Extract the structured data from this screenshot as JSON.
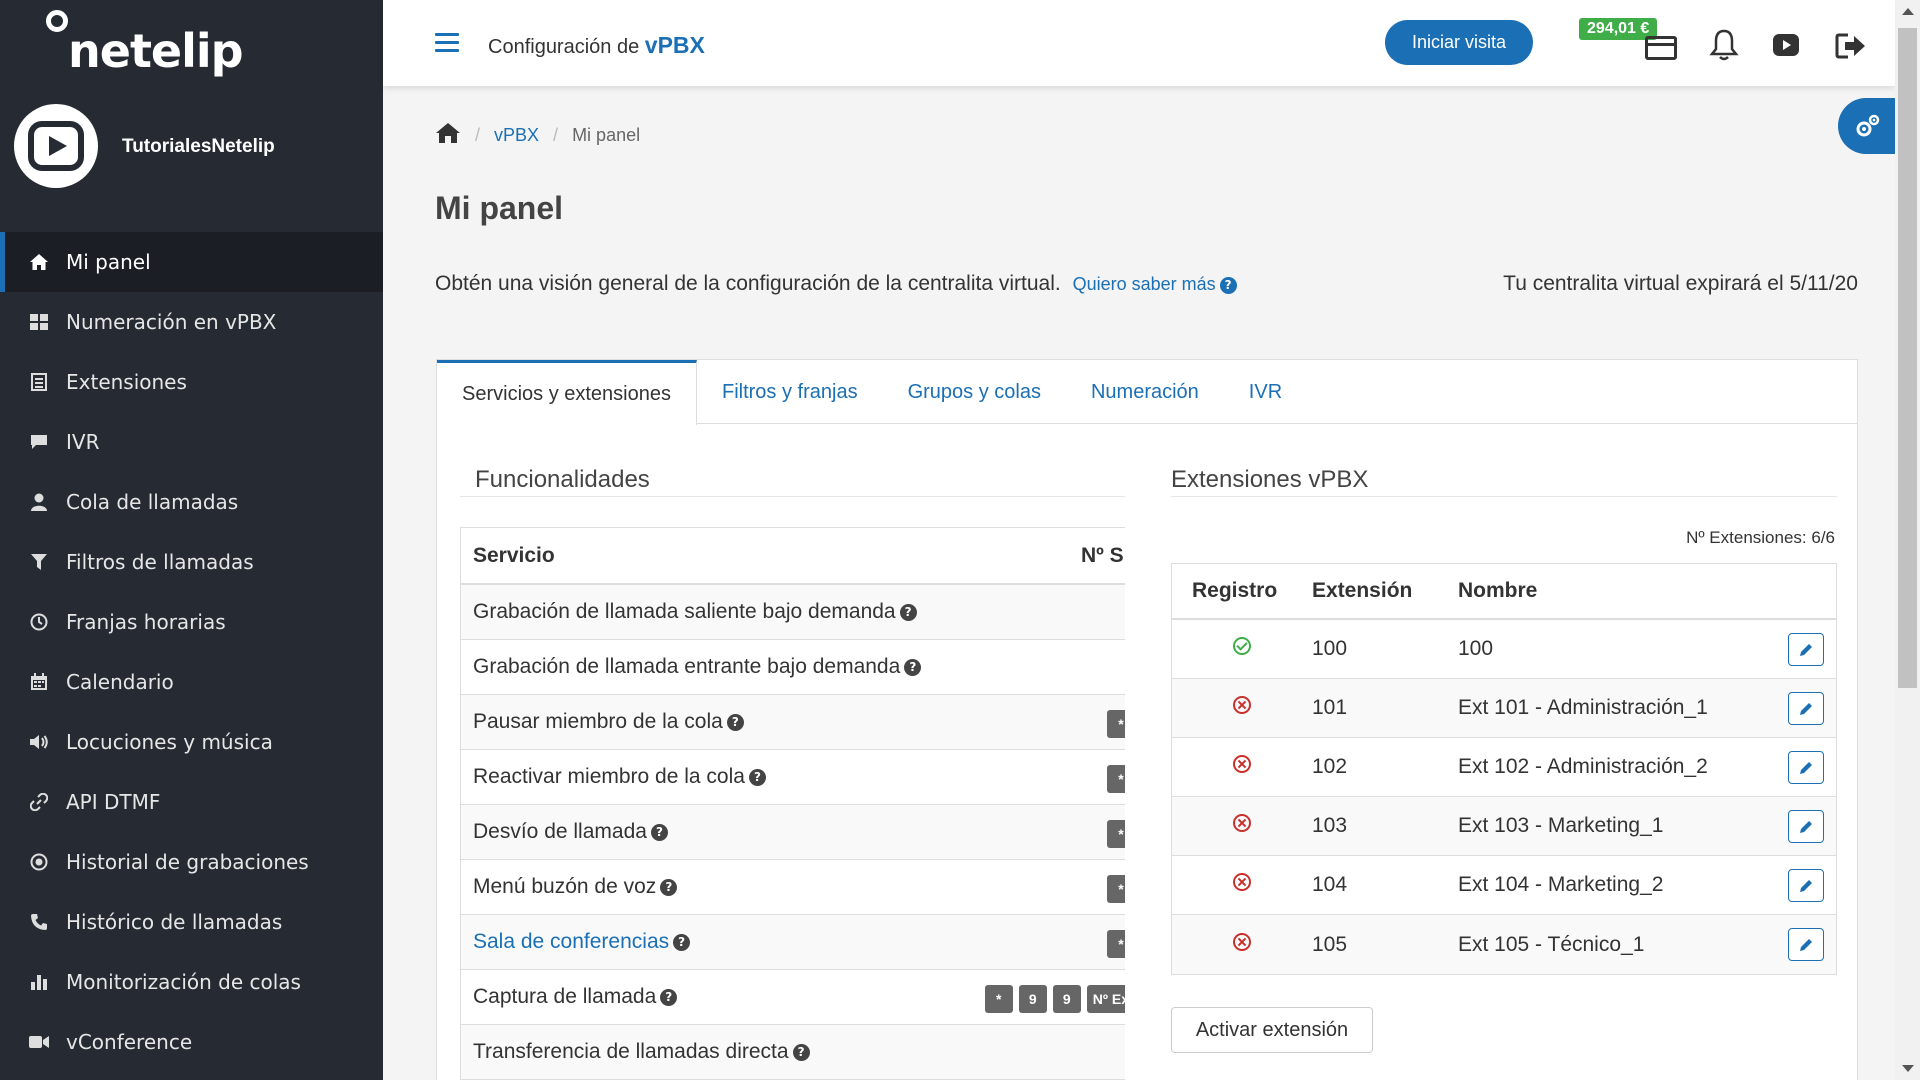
{
  "sidebar": {
    "logo": "netelip",
    "user_name": "TutorialesNetelip",
    "items": [
      {
        "label": "Mi panel",
        "icon": "home-icon",
        "active": true
      },
      {
        "label": "Numeración en vPBX",
        "icon": "grid-icon"
      },
      {
        "label": "Extensiones",
        "icon": "list-icon"
      },
      {
        "label": "IVR",
        "icon": "comment-icon"
      },
      {
        "label": "Cola de llamadas",
        "icon": "user-icon"
      },
      {
        "label": "Filtros de llamadas",
        "icon": "filter-icon"
      },
      {
        "label": "Franjas horarias",
        "icon": "clock-icon"
      },
      {
        "label": "Calendario",
        "icon": "calendar-icon"
      },
      {
        "label": "Locuciones y música",
        "icon": "volume-icon"
      },
      {
        "label": "API DTMF",
        "icon": "link-icon"
      },
      {
        "label": "Historial de grabaciones",
        "icon": "record-icon"
      },
      {
        "label": "Histórico de llamadas",
        "icon": "phone-icon"
      },
      {
        "label": "Monitorización de colas",
        "icon": "bar-chart-icon"
      },
      {
        "label": "vConference",
        "icon": "video-camera-icon"
      }
    ]
  },
  "header": {
    "title_prefix": "Configuración de",
    "title_brand": "vPBX",
    "visit_button": "Iniciar visita",
    "balance": "294,01 €"
  },
  "breadcrumb": {
    "level1": "vPBX",
    "level2": "Mi panel"
  },
  "page": {
    "title": "Mi panel",
    "description": "Obtén una visión general de la configuración de la centralita virtual.",
    "more_link": "Quiero saber más",
    "expiry": "Tu centralita virtual expirará el 5/11/20"
  },
  "tabs": [
    "Servicios y extensiones",
    "Filtros y franjas",
    "Grupos y colas",
    "Numeración",
    "IVR"
  ],
  "funcionalidades": {
    "title": "Funcionalidades",
    "headers": [
      "Servicio",
      "Nº S"
    ],
    "rows": [
      {
        "label": "Grabación de llamada saliente bajo demanda",
        "keys": []
      },
      {
        "label": "Grabación de llamada entrante bajo demanda",
        "keys": []
      },
      {
        "label": "Pausar miembro de la cola",
        "keys": [
          "*"
        ]
      },
      {
        "label": "Reactivar miembro de la cola",
        "keys": [
          "*"
        ]
      },
      {
        "label": "Desvío de llamada",
        "keys": [
          "*"
        ]
      },
      {
        "label": "Menú buzón de voz",
        "keys": [
          "*"
        ]
      },
      {
        "label": "Sala de conferencias",
        "keys": [
          "*"
        ],
        "link": true
      },
      {
        "label": "Captura de llamada",
        "keys": [
          "*",
          "9",
          "9",
          "Nº Ex"
        ]
      },
      {
        "label": "Transferencia de llamadas directa",
        "keys": []
      }
    ]
  },
  "extensiones": {
    "title": "Extensiones vPBX",
    "count": "Nº Extensiones: 6/6",
    "headers": [
      "Registro",
      "Extensión",
      "Nombre"
    ],
    "rows": [
      {
        "status": "ok",
        "ext": "100",
        "name": "100"
      },
      {
        "status": "err",
        "ext": "101",
        "name": "Ext 101 - Administración_1"
      },
      {
        "status": "err",
        "ext": "102",
        "name": "Ext 102 - Administración_2"
      },
      {
        "status": "err",
        "ext": "103",
        "name": "Ext 103 - Marketing_1"
      },
      {
        "status": "err",
        "ext": "104",
        "name": "Ext 104 - Marketing_2"
      },
      {
        "status": "err",
        "ext": "105",
        "name": "Ext 105 - Técnico_1"
      }
    ],
    "activate_button": "Activar extensión"
  },
  "colors": {
    "accent": "#1b6fb4",
    "sidebar_bg": "#262b33",
    "balance_bg": "#3fae49",
    "error": "#c9302c",
    "ok": "#3fae49"
  }
}
